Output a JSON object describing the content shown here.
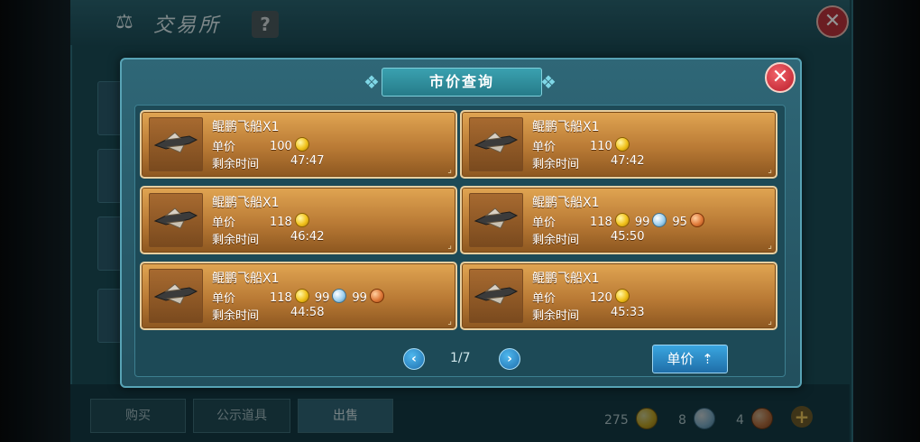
{
  "background": {
    "title": "交易所",
    "help_label": "?",
    "close_icon": "close-icon",
    "tabs": [
      {
        "label": "购买"
      },
      {
        "label": "公示道具"
      },
      {
        "label": "出售"
      }
    ],
    "currency": {
      "gold": "275",
      "silver": "8",
      "copper": "4"
    }
  },
  "dialog": {
    "title": "市价查询",
    "listings": [
      {
        "name": "鲲鹏飞船X1",
        "price_label": "单价",
        "time_label": "剩余时间",
        "gold": "100",
        "silver": "",
        "copper": "",
        "time": "47:47"
      },
      {
        "name": "鲲鹏飞船X1",
        "price_label": "单价",
        "time_label": "剩余时间",
        "gold": "110",
        "silver": "",
        "copper": "",
        "time": "47:42"
      },
      {
        "name": "鲲鹏飞船X1",
        "price_label": "单价",
        "time_label": "剩余时间",
        "gold": "118",
        "silver": "",
        "copper": "",
        "time": "46:42"
      },
      {
        "name": "鲲鹏飞船X1",
        "price_label": "单价",
        "time_label": "剩余时间",
        "gold": "118",
        "silver": "99",
        "copper": "95",
        "time": "45:50"
      },
      {
        "name": "鲲鹏飞船X1",
        "price_label": "单价",
        "time_label": "剩余时间",
        "gold": "118",
        "silver": "99",
        "copper": "99",
        "time": "44:58"
      },
      {
        "name": "鲲鹏飞船X1",
        "price_label": "单价",
        "time_label": "剩余时间",
        "gold": "120",
        "silver": "",
        "copper": "",
        "time": "45:33"
      }
    ],
    "pager": {
      "text": "1/7"
    },
    "sort_button": {
      "label": "单价"
    }
  },
  "colors": {
    "card_border": "#e8cfa0",
    "accent": "#2f6777",
    "close": "#b91d2b"
  }
}
